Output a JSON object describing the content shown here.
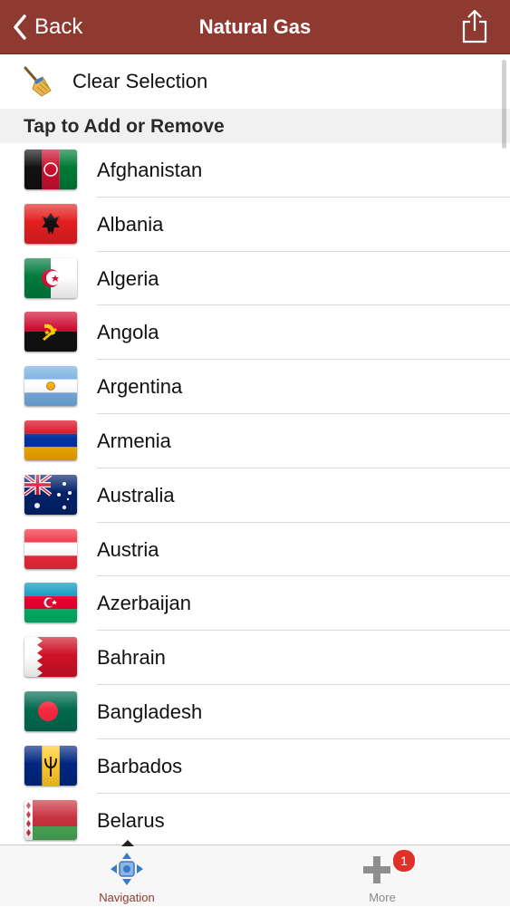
{
  "navbar": {
    "back_label": "Back",
    "title": "Natural Gas",
    "share_icon": "share-icon",
    "background": "#8e3a31"
  },
  "actions": {
    "clear_label": "Clear Selection",
    "clear_icon": "broom-icon"
  },
  "section": {
    "header": "Tap to Add or Remove"
  },
  "countries": [
    {
      "name": "Afghanistan",
      "flag": "afghanistan-flag-icon"
    },
    {
      "name": "Albania",
      "flag": "albania-flag-icon"
    },
    {
      "name": "Algeria",
      "flag": "algeria-flag-icon"
    },
    {
      "name": "Angola",
      "flag": "angola-flag-icon"
    },
    {
      "name": "Argentina",
      "flag": "argentina-flag-icon"
    },
    {
      "name": "Armenia",
      "flag": "armenia-flag-icon"
    },
    {
      "name": "Australia",
      "flag": "australia-flag-icon"
    },
    {
      "name": "Austria",
      "flag": "austria-flag-icon"
    },
    {
      "name": "Azerbaijan",
      "flag": "azerbaijan-flag-icon"
    },
    {
      "name": "Bahrain",
      "flag": "bahrain-flag-icon"
    },
    {
      "name": "Bangladesh",
      "flag": "bangladesh-flag-icon"
    },
    {
      "name": "Barbados",
      "flag": "barbados-flag-icon"
    },
    {
      "name": "Belarus",
      "flag": "belarus-flag-icon"
    }
  ],
  "tabbar": {
    "tabs": [
      {
        "label": "Navigation",
        "icon": "navigation-arrows-icon",
        "active": true
      },
      {
        "label": "More",
        "icon": "plus-icon",
        "active": false,
        "badge": "1"
      }
    ],
    "active_color": "#8e3a31",
    "badge_color": "#e0302a"
  }
}
